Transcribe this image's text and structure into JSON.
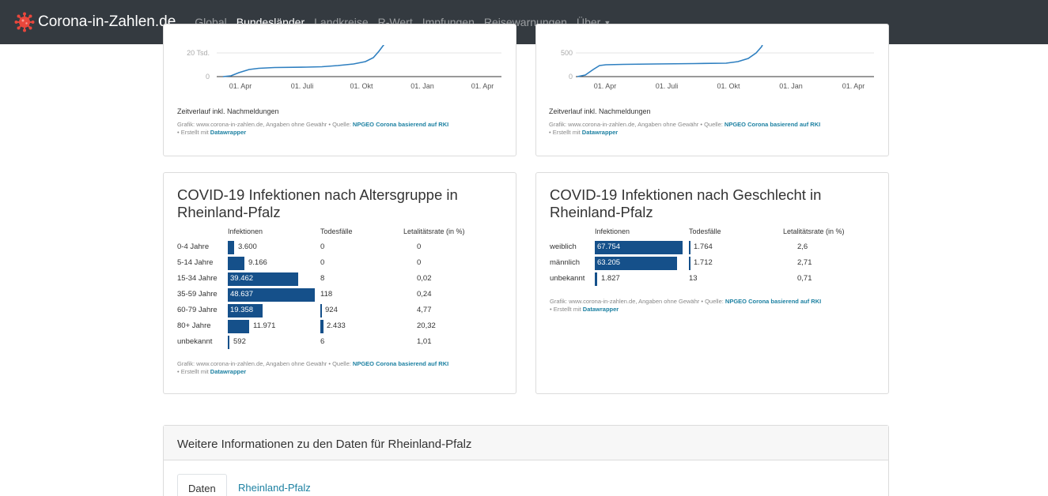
{
  "nav": {
    "brand": "Corona-in-Zahlen.de",
    "items": [
      {
        "label": "Global",
        "active": false
      },
      {
        "label": "Bundesländer",
        "active": true
      },
      {
        "label": "Landkreise",
        "active": false
      },
      {
        "label": "R-Wert",
        "active": false
      },
      {
        "label": "Impfungen",
        "active": false
      },
      {
        "label": "Reisewarnungen",
        "active": false
      },
      {
        "label": "Über",
        "active": false
      }
    ],
    "dropdown_caret": "▼"
  },
  "timeline_left": {
    "y_ticks": [
      "20 Tsd.",
      "0"
    ],
    "x_ticks": [
      "01. Apr",
      "01. Juli",
      "01. Okt",
      "01. Jan",
      "01. Apr"
    ],
    "note": "Zeitverlauf inkl. Nachmeldungen"
  },
  "timeline_right": {
    "y_ticks": [
      "500",
      "0"
    ],
    "x_ticks": [
      "01. Apr",
      "01. Juli",
      "01. Okt",
      "01. Jan",
      "01. Apr"
    ],
    "note": "Zeitverlauf inkl. Nachmeldungen"
  },
  "credit": {
    "prefix": "Grafik: www.corona-in-zahlen.de, Angaben ohne Gewähr • Quelle: ",
    "source": "NPGEO Corona basierend auf RKI",
    "made_prefix": "• Erstellt mit ",
    "tool": "Datawrapper"
  },
  "age_card": {
    "title_line1": "COVID-19 Infektionen nach Altersgruppe in",
    "title_line2": "Rheinland-Pfalz",
    "headers": {
      "infections": "Infektionen",
      "deaths": "Todesfälle",
      "rate": "Letalitätsrate (in %)"
    },
    "rows": [
      {
        "label": "0-4 Jahre",
        "infections": "3.600",
        "deaths": "0",
        "rate": "0"
      },
      {
        "label": "5-14 Jahre",
        "infections": "9.166",
        "deaths": "0",
        "rate": "0"
      },
      {
        "label": "15-34 Jahre",
        "infections": "39.462",
        "deaths": "8",
        "rate": "0,02"
      },
      {
        "label": "35-59 Jahre",
        "infections": "48.637",
        "deaths": "118",
        "rate": "0,24"
      },
      {
        "label": "60-79 Jahre",
        "infections": "19.358",
        "deaths": "924",
        "rate": "4,77"
      },
      {
        "label": "80+ Jahre",
        "infections": "11.971",
        "deaths": "2.433",
        "rate": "20,32"
      },
      {
        "label": "unbekannt",
        "infections": "592",
        "deaths": "6",
        "rate": "1,01"
      }
    ]
  },
  "sex_card": {
    "title_line1": "COVID-19 Infektionen nach Geschlecht in",
    "title_line2": "Rheinland-Pfalz",
    "headers": {
      "infections": "Infektionen",
      "deaths": "Todesfälle",
      "rate": "Letalitätsrate (in %)"
    },
    "rows": [
      {
        "label": "weiblich",
        "infections": "67.754",
        "deaths": "1.764",
        "rate": "2,6"
      },
      {
        "label": "männlich",
        "infections": "63.205",
        "deaths": "1.712",
        "rate": "2,71"
      },
      {
        "label": "unbekannt",
        "infections": "1.827",
        "deaths": "13",
        "rate": "0,71"
      }
    ]
  },
  "info_panel": {
    "title": "Weitere Informationen zu den Daten für Rheinland-Pfalz",
    "tabs": [
      {
        "label": "Daten",
        "active": true
      },
      {
        "label": "Rheinland-Pfalz",
        "active": false
      }
    ]
  },
  "colors": {
    "navbar": "#343a40",
    "bar": "#15508a",
    "line": "#2e7fc0",
    "link": "#1d81a2"
  }
}
